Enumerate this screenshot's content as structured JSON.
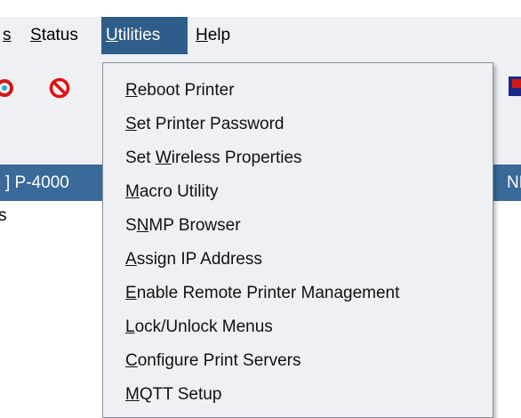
{
  "menubar": {
    "items": [
      {
        "pre": "",
        "u": "s",
        "post": ""
      },
      {
        "pre": "",
        "u": "S",
        "post": "tatus"
      },
      {
        "pre": "",
        "u": "U",
        "post": "tilities"
      },
      {
        "pre": "",
        "u": "H",
        "post": "elp"
      }
    ]
  },
  "utilities_menu": {
    "items": [
      {
        "pre": "",
        "u": "R",
        "post": "eboot Printer"
      },
      {
        "pre": "",
        "u": "S",
        "post": "et Printer Password"
      },
      {
        "pre": "Set ",
        "u": "W",
        "post": "ireless Properties"
      },
      {
        "pre": "",
        "u": "M",
        "post": "acro Utility"
      },
      {
        "pre": "S",
        "u": "N",
        "post": "MP Browser"
      },
      {
        "pre": "",
        "u": "A",
        "post": "ssign IP Address"
      },
      {
        "pre": "",
        "u": "E",
        "post": "nable Remote Printer Management"
      },
      {
        "pre": "",
        "u": "L",
        "post": "ock/Unlock Menus"
      },
      {
        "pre": "",
        "u": "C",
        "post": "onfigure Print Servers"
      },
      {
        "pre": "",
        "u": "M",
        "post": "QTT Setup"
      }
    ]
  },
  "device_panel": {
    "title_left": "] P-4000",
    "title_right": "NL",
    "row_text": "s"
  },
  "toolbar": {
    "icons": [
      "refresh-icon",
      "stop-icon",
      "device-icon"
    ]
  },
  "colors": {
    "menu_bg": "#eef0f3",
    "menu_active": "#2f5d8a",
    "title_bar": "#3a6a9a",
    "stop_red": "#e01010"
  }
}
